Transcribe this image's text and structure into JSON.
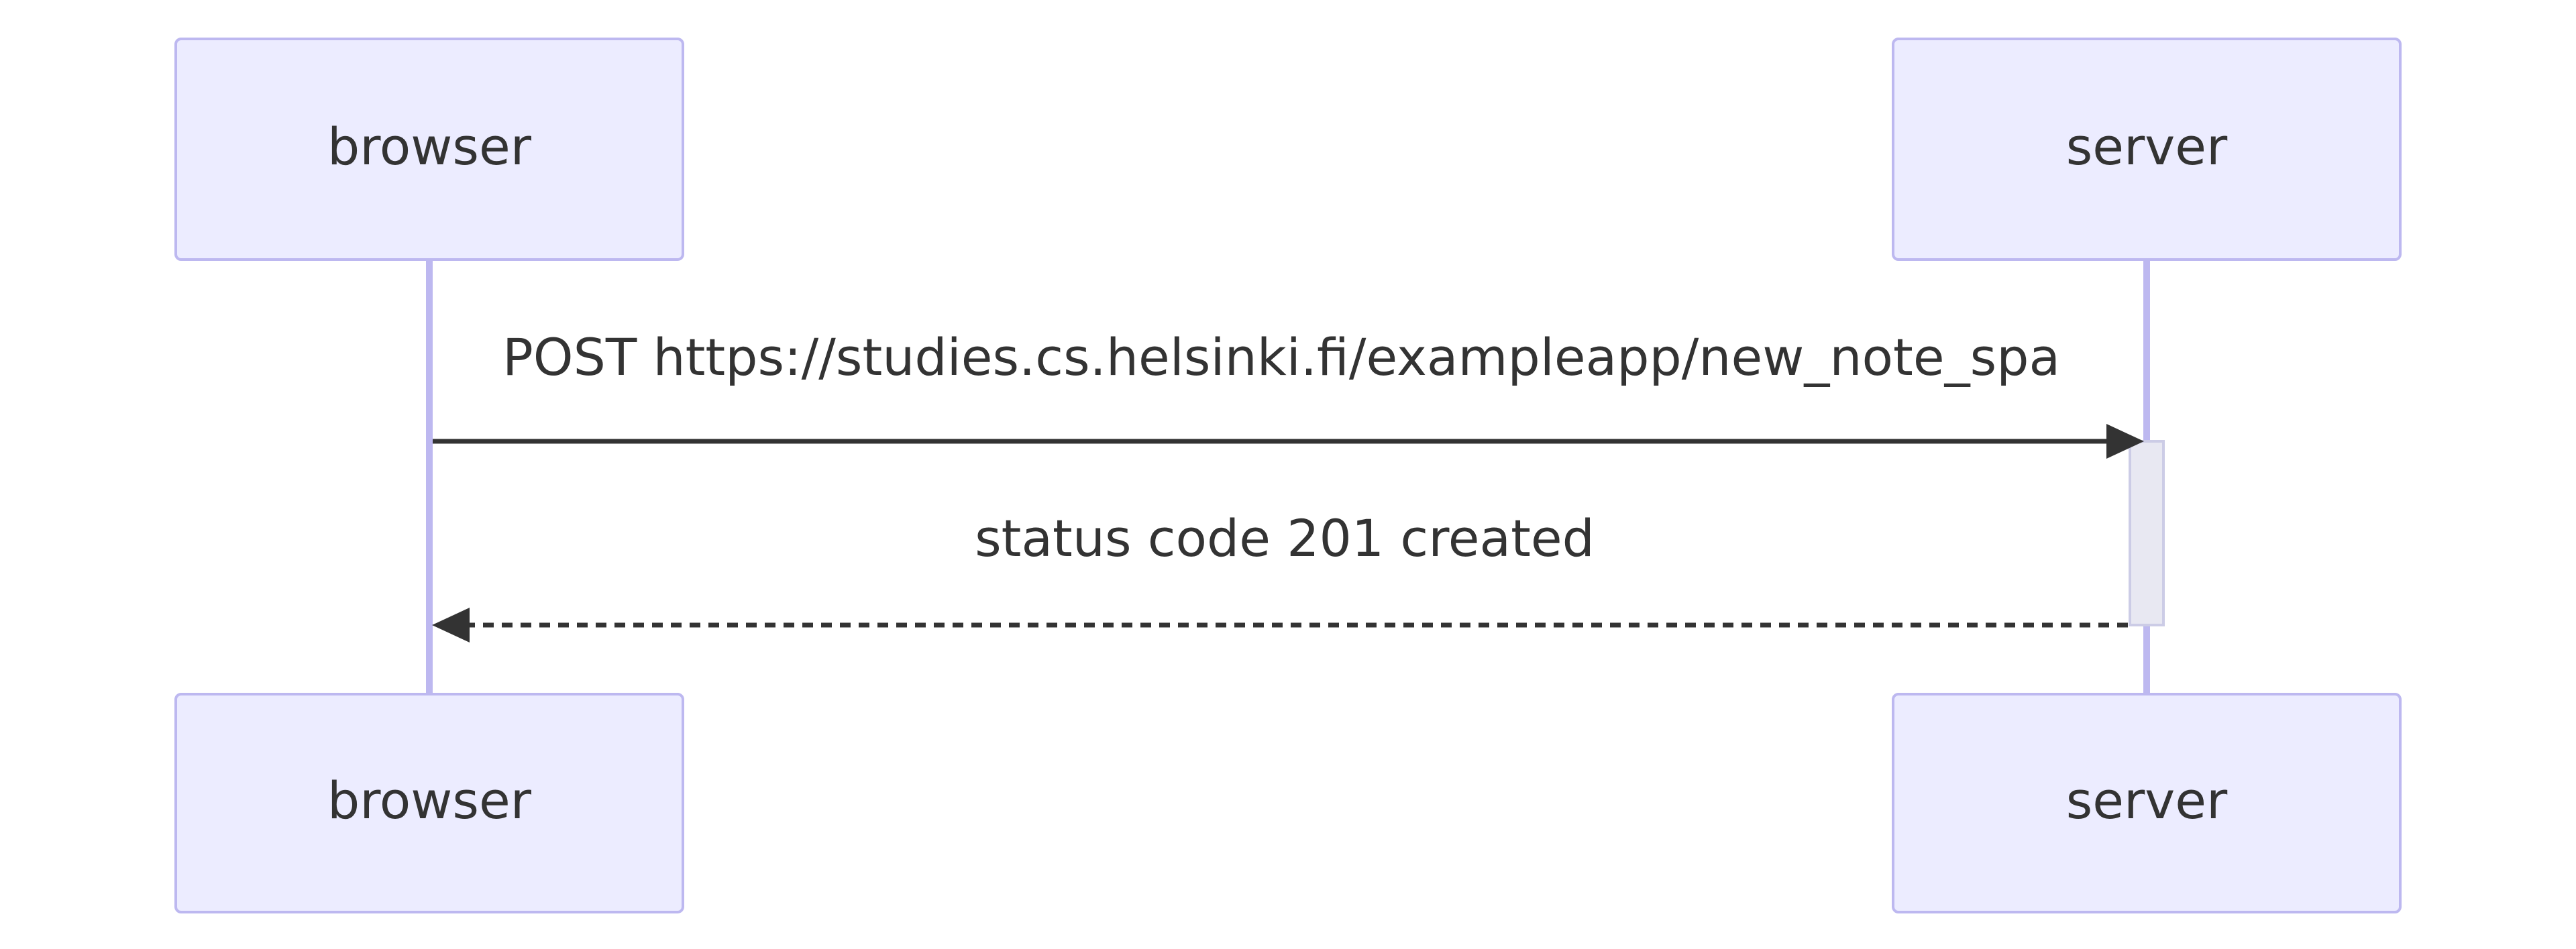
{
  "actors": {
    "browser": "browser",
    "server": "server"
  },
  "messages": [
    {
      "from": "browser",
      "to": "server",
      "style": "solid",
      "label": "POST https://studies.cs.helsinki.fi/exampleapp/new_note_spa"
    },
    {
      "from": "server",
      "to": "browser",
      "style": "dashed",
      "label": "status code 201 created"
    }
  ],
  "colors": {
    "actor_fill": "#ECECFF",
    "actor_border": "#BDB8F0",
    "lifeline": "#BDB8F0",
    "activation_fill": "#E8E8F2",
    "text": "#333333"
  }
}
